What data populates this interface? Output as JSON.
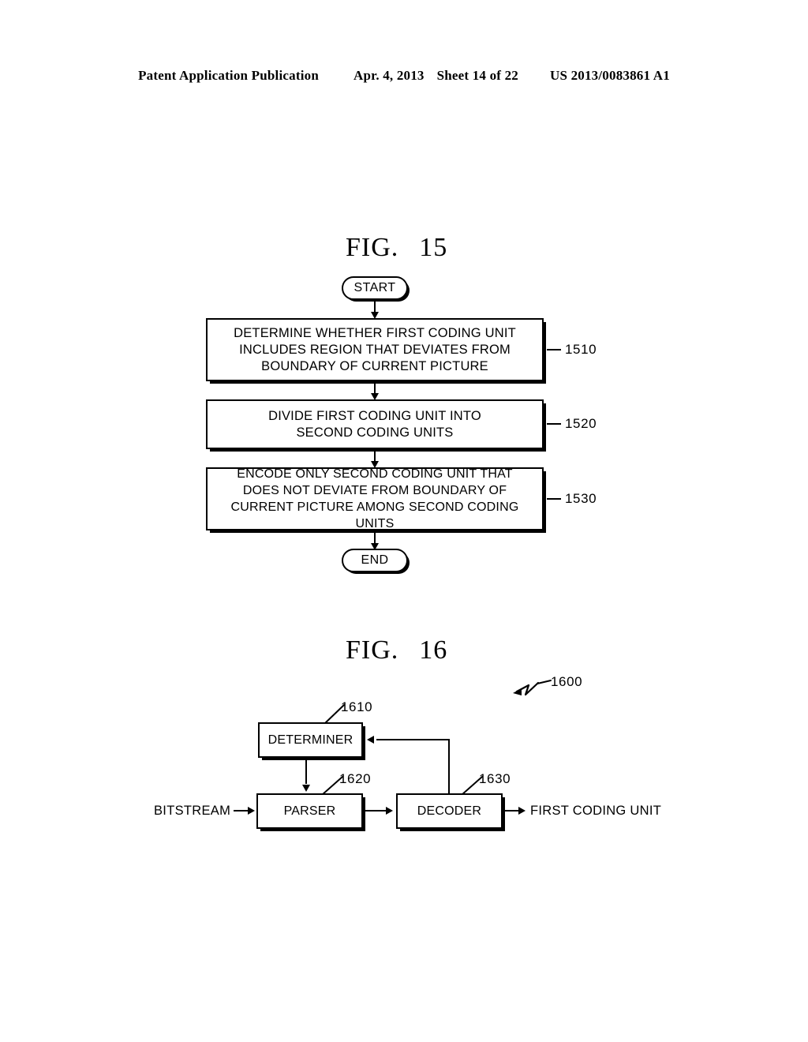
{
  "header": {
    "publication": "Patent Application Publication",
    "date": "Apr. 4, 2013",
    "sheet": "Sheet 14 of 22",
    "patent_number": "US 2013/0083861 A1"
  },
  "figures": [
    {
      "label": "FIG.",
      "number": "15",
      "type": "flowchart",
      "nodes": {
        "start": "START",
        "end": "END",
        "steps": [
          {
            "ref": "1510",
            "text": "DETERMINE WHETHER FIRST CODING UNIT\nINCLUDES REGION THAT DEVIATES FROM\nBOUNDARY OF CURRENT PICTURE"
          },
          {
            "ref": "1520",
            "text": "DIVIDE FIRST CODING UNIT INTO\nSECOND CODING UNITS"
          },
          {
            "ref": "1530",
            "text": "ENCODE ONLY SECOND CODING UNIT THAT\nDOES NOT DEVIATE FROM BOUNDARY OF\nCURRENT PICTURE AMONG SECOND CODING UNITS"
          }
        ]
      }
    },
    {
      "label": "FIG.",
      "number": "16",
      "type": "block-diagram",
      "apparatus_ref": "1600",
      "blocks": [
        {
          "ref": "1610",
          "label": "DETERMINER"
        },
        {
          "ref": "1620",
          "label": "PARSER"
        },
        {
          "ref": "1630",
          "label": "DECODER"
        }
      ],
      "input_label": "BITSTREAM",
      "output_label": "FIRST CODING UNIT"
    }
  ]
}
